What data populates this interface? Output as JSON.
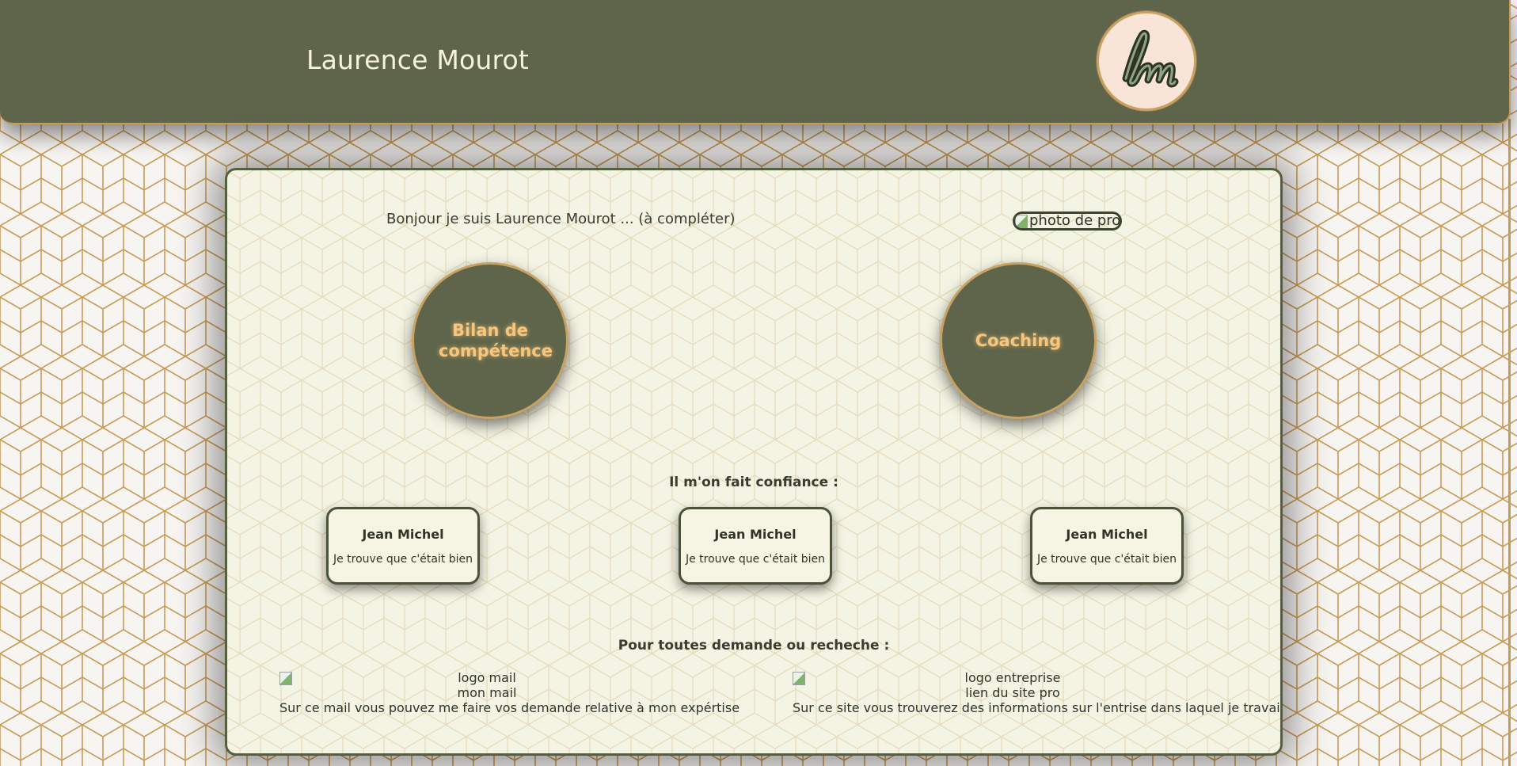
{
  "header": {
    "title": "Laurence Mourot",
    "logo_text": "lm"
  },
  "intro": {
    "text": "Bonjour je suis Laurence Mourot ... (à compléter)",
    "profile_alt": "photo de profil"
  },
  "services": [
    {
      "label": "Bilan de compétence"
    },
    {
      "label": "Coaching"
    }
  ],
  "testimonials": {
    "title": "Il m'on fait confiance :",
    "items": [
      {
        "name": "Jean Michel",
        "quote": "Je trouve que c'était bien"
      },
      {
        "name": "Jean Michel",
        "quote": "Je trouve que c'était bien"
      },
      {
        "name": "Jean Michel",
        "quote": "Je trouve que c'était bien"
      }
    ]
  },
  "contact": {
    "title": "Pour toutes demande ou recheche :",
    "mail": {
      "img_alt": "logo mail",
      "link": "mon mail",
      "desc": "Sur ce mail vous pouvez me faire vos demande relative à mon expértise"
    },
    "site": {
      "img_alt": "logo entreprise",
      "link": "lien du site pro",
      "desc": "Sur ce site vous trouverez des informations sur l'entrise dans laquel je travail"
    }
  },
  "colors": {
    "header_bg": "#5f654a",
    "accent_gold": "#c9a263",
    "circle_text": "#f7c67c",
    "card_bg": "#f4f4e4"
  }
}
